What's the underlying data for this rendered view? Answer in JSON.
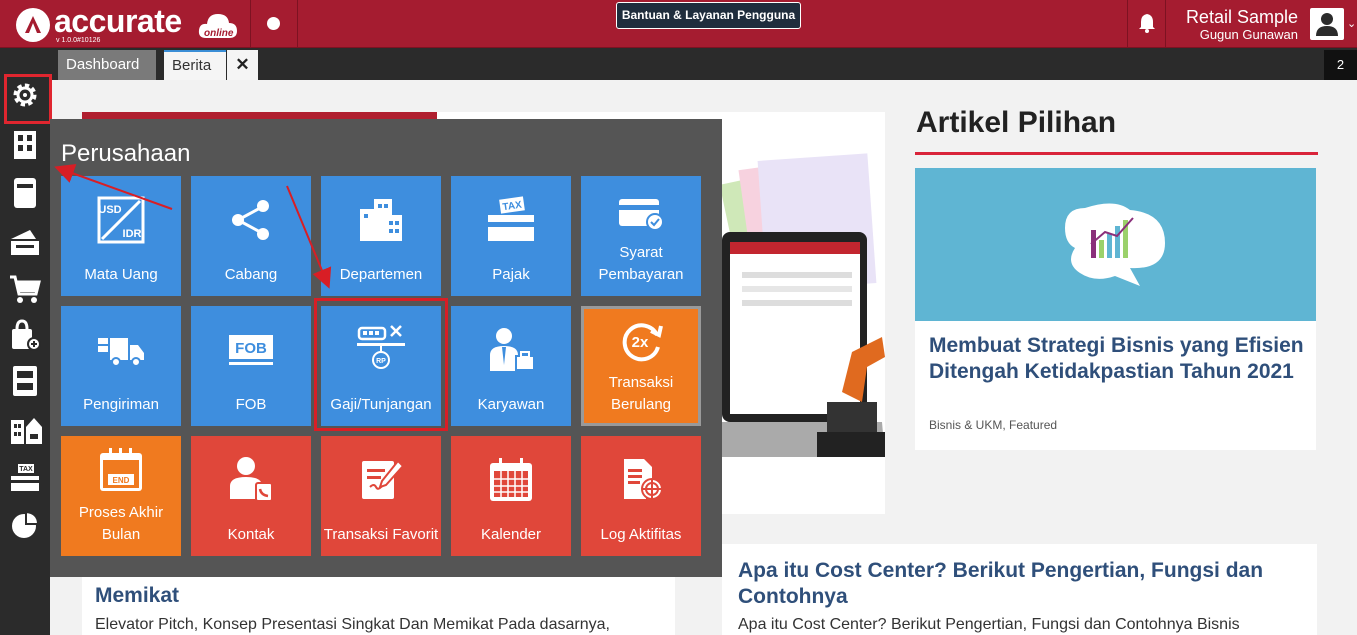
{
  "header": {
    "logo_text": "accurate",
    "logo_sub": "online",
    "version": "v 1.0.0#10126",
    "help_button": "Bantuan & Layanan Pengguna",
    "company": "Retail Sample",
    "user": "Gugun Gunawan",
    "brand_color": "#a51c30"
  },
  "tabs": {
    "dashboard": "Dashboard",
    "berita": "Berita",
    "close": "✕",
    "count": "2"
  },
  "sidebar": {
    "items": [
      {
        "icon": "settings-gear-icon"
      },
      {
        "icon": "company-building-icon"
      },
      {
        "icon": "ledger-book-icon"
      },
      {
        "icon": "cash-drawer-icon"
      },
      {
        "icon": "shopping-cart-icon"
      },
      {
        "icon": "shopping-bag-icon"
      },
      {
        "icon": "inventory-cabinet-icon"
      },
      {
        "icon": "asset-building-icon"
      },
      {
        "icon": "tax-icon"
      },
      {
        "icon": "report-pie-icon"
      }
    ]
  },
  "popup": {
    "title": "Perusahaan",
    "tiles": [
      {
        "label": "Mata Uang",
        "color": "#3e8ede",
        "icon": "currency-icon"
      },
      {
        "label": "Cabang",
        "color": "#3e8ede",
        "icon": "branch-share-icon"
      },
      {
        "label": "Departemen",
        "color": "#3e8ede",
        "icon": "department-building-icon"
      },
      {
        "label": "Pajak",
        "color": "#3e8ede",
        "icon": "tax-icon"
      },
      {
        "label": "Syarat Pembayaran",
        "color": "#3e8ede",
        "icon": "payment-card-icon"
      },
      {
        "label": "Pengiriman",
        "color": "#3e8ede",
        "icon": "truck-icon"
      },
      {
        "label": "FOB",
        "color": "#3e8ede",
        "icon": "fob-icon"
      },
      {
        "label": "Gaji/Tunjangan",
        "color": "#3e8ede",
        "icon": "salary-allowance-icon"
      },
      {
        "label": "Karyawan",
        "color": "#3e8ede",
        "icon": "employee-icon"
      },
      {
        "label": "Transaksi Berulang",
        "color": "#f07a1f",
        "icon": "recurring-2x-icon"
      },
      {
        "label": "Proses Akhir Bulan",
        "color": "#f07a1f",
        "icon": "month-end-calendar-icon"
      },
      {
        "label": "Kontak",
        "color": "#e0473a",
        "icon": "contact-icon"
      },
      {
        "label": "Transaksi Favorit",
        "color": "#e0473a",
        "icon": "favorite-transaction-icon"
      },
      {
        "label": "Kalender",
        "color": "#e0473a",
        "icon": "calendar-icon"
      },
      {
        "label": "Log Aktifitas",
        "color": "#e0473a",
        "icon": "activity-log-icon"
      }
    ]
  },
  "articles": {
    "section_title": "Artikel Pilihan",
    "featured": {
      "title": "Membuat Strategi Bisnis yang Efisien Ditengah Ketidakpastian Tahun 2021",
      "category": "Bisnis & UKM, Featured"
    },
    "second": {
      "title": "Apa itu Cost Center? Berikut Pengertian, Fungsi dan Contohnya",
      "excerpt": "Apa itu Cost Center? Berikut Pengertian, Fungsi dan Contohnya Bisnis"
    },
    "third": {
      "title": "Memikat",
      "excerpt": "Elevator Pitch, Konsep Presentasi Singkat Dan Memikat Pada dasarnya,"
    }
  }
}
